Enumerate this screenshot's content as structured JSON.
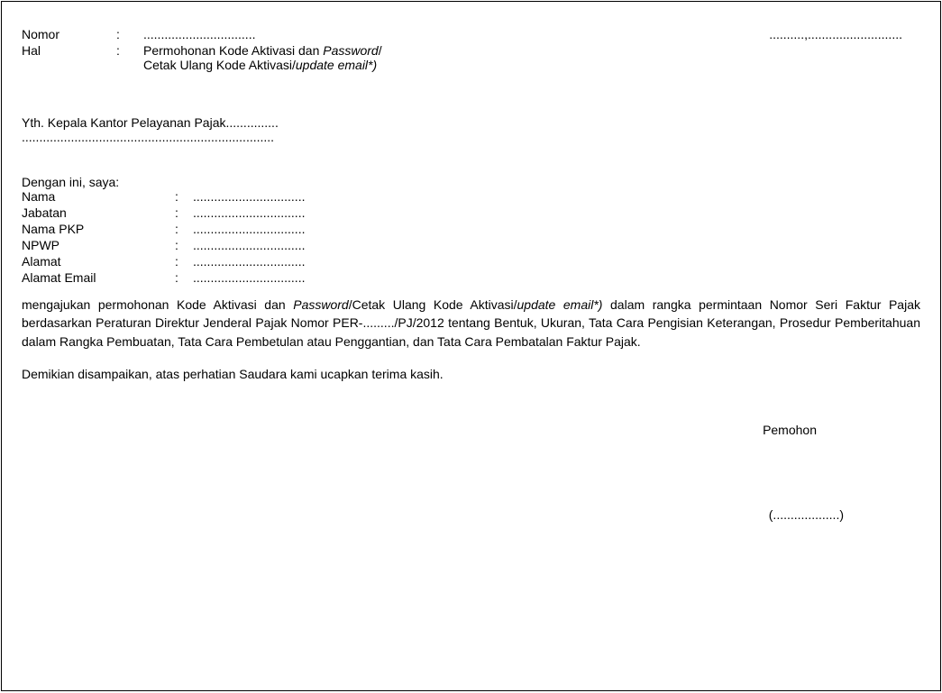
{
  "header": {
    "nomor_label": "Nomor",
    "nomor_value": "................................",
    "date_placeholder": "..........,...........................",
    "hal_label": "Hal",
    "hal_line1_plain1": "Permohonan Kode Aktivasi dan ",
    "hal_line1_italic": "Password",
    "hal_line1_plain2": "/",
    "hal_line2_plain1": "Cetak Ulang Kode Aktivasi/",
    "hal_line2_italic": "update email*)"
  },
  "recipient": {
    "line1": "Yth. Kepala Kantor Pelayanan Pajak...............",
    "line2": "........................................................................"
  },
  "intro": "Dengan ini, saya:",
  "fields": {
    "nama_label": "Nama",
    "nama_value": "................................",
    "jabatan_label": "Jabatan",
    "jabatan_value": "................................",
    "namapkp_label": "Nama PKP",
    "namapkp_value": "................................",
    "npwp_label": "NPWP",
    "npwp_value": "................................",
    "alamat_label": "Alamat",
    "alamat_value": "................................",
    "email_label": "Alamat Email",
    "email_value": "................................"
  },
  "body": {
    "seg1": "mengajukan permohonan Kode Aktivasi dan ",
    "seg2_italic": "Password",
    "seg3": "/Cetak Ulang Kode Aktivasi/",
    "seg4_italic": "update email*)",
    "seg5": " dalam rangka permintaan Nomor Seri Faktur Pajak berdasarkan Peraturan Direktur Jenderal Pajak Nomor PER-........./PJ/2012 tentang Bentuk, Ukuran, Tata Cara Pengisian Keterangan, Prosedur Pemberitahuan dalam Rangka Pembuatan, Tata Cara Pembetulan atau Penggantian, dan Tata Cara Pembatalan Faktur Pajak."
  },
  "closing": "Demikian disampaikan, atas perhatian Saudara kami ucapkan terima kasih.",
  "signature": {
    "label": "Pemohon",
    "name_placeholder": "(...................)"
  }
}
